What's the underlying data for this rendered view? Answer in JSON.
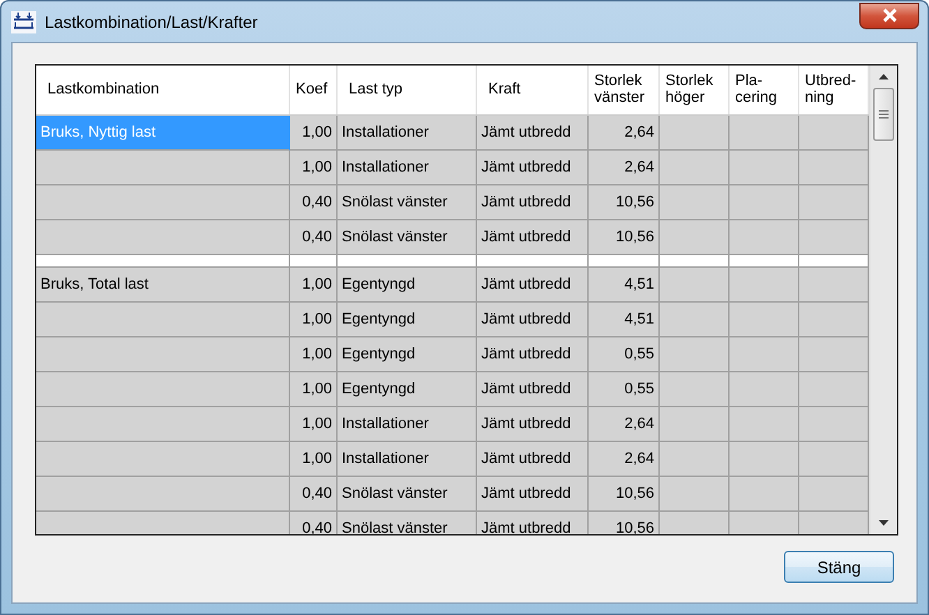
{
  "window": {
    "title": "Lastkombination/Last/Krafter"
  },
  "table": {
    "columns": [
      "Lastkombination",
      "Koef",
      "Last typ",
      "Kraft",
      "Storlek vänster",
      "Storlek höger",
      "Pla-cering",
      "Utbred-ning"
    ],
    "rows": [
      {
        "kind": "data",
        "selected": true,
        "cells": [
          "Bruks, Nyttig last",
          "1,00",
          "Installationer",
          "Jämt utbredd",
          "2,64"
        ]
      },
      {
        "kind": "data",
        "selected": false,
        "cells": [
          "",
          "1,00",
          "Installationer",
          "Jämt utbredd",
          "2,64"
        ]
      },
      {
        "kind": "data",
        "selected": false,
        "cells": [
          "",
          "0,40",
          "Snölast vänster",
          "Jämt utbredd",
          "10,56"
        ]
      },
      {
        "kind": "data",
        "selected": false,
        "cells": [
          "",
          "0,40",
          "Snölast vänster",
          "Jämt utbredd",
          "10,56"
        ]
      },
      {
        "kind": "separator"
      },
      {
        "kind": "data",
        "selected": false,
        "cells": [
          "Bruks, Total last",
          "1,00",
          "Egentyngd",
          "Jämt utbredd",
          "4,51"
        ]
      },
      {
        "kind": "data",
        "selected": false,
        "cells": [
          "",
          "1,00",
          "Egentyngd",
          "Jämt utbredd",
          "4,51"
        ]
      },
      {
        "kind": "data",
        "selected": false,
        "cells": [
          "",
          "1,00",
          "Egentyngd",
          "Jämt utbredd",
          "0,55"
        ]
      },
      {
        "kind": "data",
        "selected": false,
        "cells": [
          "",
          "1,00",
          "Egentyngd",
          "Jämt utbredd",
          "0,55"
        ]
      },
      {
        "kind": "data",
        "selected": false,
        "cells": [
          "",
          "1,00",
          "Installationer",
          "Jämt utbredd",
          "2,64"
        ]
      },
      {
        "kind": "data",
        "selected": false,
        "cells": [
          "",
          "1,00",
          "Installationer",
          "Jämt utbredd",
          "2,64"
        ]
      },
      {
        "kind": "data",
        "selected": false,
        "cells": [
          "",
          "0,40",
          "Snölast vänster",
          "Jämt utbredd",
          "10,56"
        ]
      },
      {
        "kind": "data",
        "selected": false,
        "cells": [
          "",
          "0,40",
          "Snölast vänster",
          "Jämt utbredd",
          "10,56"
        ]
      }
    ]
  },
  "buttons": [
    "Stäng"
  ]
}
